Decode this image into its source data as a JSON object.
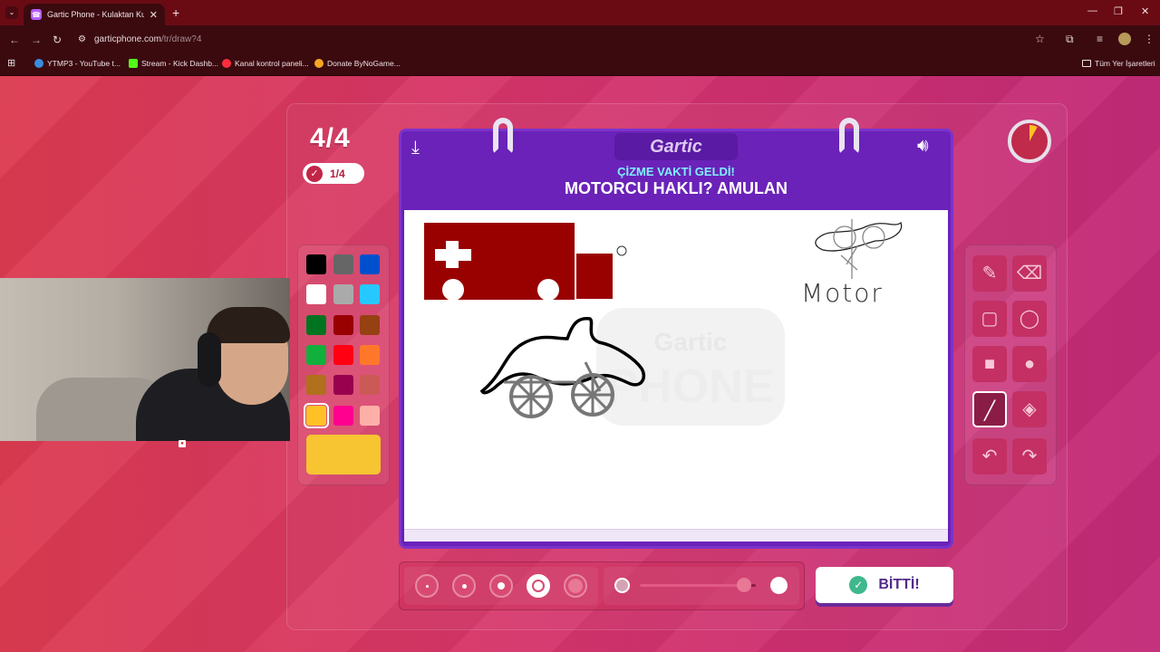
{
  "browser": {
    "tab_title": "Gartic Phone - Kulaktan Kulağa",
    "url_host": "garticphone.com",
    "url_path": "/tr/draw?4",
    "bookmarks": [
      {
        "label": "YTMP3 - YouTube t...",
        "color": "#3a8dde"
      },
      {
        "label": "Stream - Kick Dashb...",
        "color": "#53fc18"
      },
      {
        "label": "Kanal kontrol paneli...",
        "color": "#ff2d3d"
      },
      {
        "label": "Donate ByNoGame...",
        "color": "#f5a623"
      }
    ],
    "all_bookmarks": "Tüm Yer İşaretleri"
  },
  "game": {
    "round": "4/4",
    "done_count": "1/4",
    "logo": "Gartic",
    "subtitle": "ÇİZME VAKTİ GELDİ!",
    "theme": "MOTORCU HAKLI? AMULAN",
    "done_button": "BİTTİ!",
    "sketch_text": "Motor",
    "watermark": "Gartic PHONE",
    "timer_fraction": 0.08
  },
  "palette": {
    "colors": [
      "#000000",
      "#666666",
      "#0050cd",
      "#ffffff",
      "#aaaaaa",
      "#26c9ff",
      "#017420",
      "#990000",
      "#964112",
      "#11b03c",
      "#ff0013",
      "#ff7829",
      "#b0701c",
      "#99004e",
      "#cb5a57",
      "#ffc126",
      "#ff008f",
      "#feafa8"
    ],
    "selected_index": 15,
    "current_color": "#f7c531"
  },
  "tools": [
    "pencil-icon",
    "eraser-icon",
    "rect-outline-icon",
    "ellipse-outline-icon",
    "rect-filled-icon",
    "ellipse-filled-icon",
    "line-icon",
    "fill-bucket-icon",
    "undo-icon",
    "redo-icon"
  ],
  "selected_tool": "line-icon",
  "brush_sizes": {
    "count": 5,
    "selected_index": 3
  },
  "opacity": {
    "value": 0.9
  }
}
